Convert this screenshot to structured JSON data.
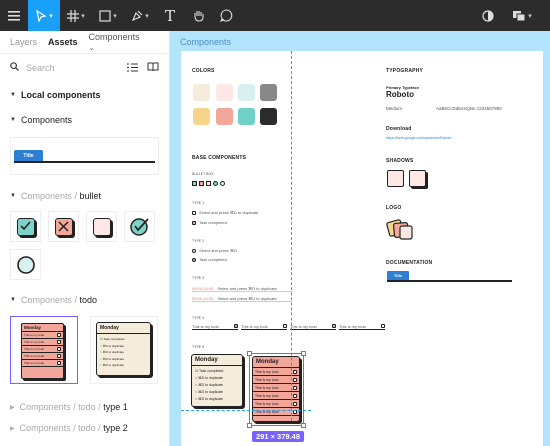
{
  "toolbar": {
    "menu_icon": "hamburger-icon",
    "move_tool_icon": "move-cursor-icon",
    "frame_tool_icon": "frame-hash-icon",
    "shape_tool_icon": "rectangle-icon",
    "pen_tool_icon": "pen-icon",
    "text_tool_icon": "T",
    "hand_tool_icon": "hand-icon",
    "comment_tool_icon": "comment-icon",
    "theme_icon": "contrast-icon",
    "component_icon": "component-icon"
  },
  "sidebar": {
    "tabs": {
      "layers": "Layers",
      "assets": "Assets",
      "library": "Components"
    },
    "search_placeholder": "Search",
    "local_components": "Local components",
    "components_header": "Components",
    "title_thumb_label": "Title",
    "bullet_group_prefix": "Components /",
    "bullet_group_name": "bullet",
    "todo_group_prefix": "Components /",
    "todo_group_name": "todo",
    "todo_thumb_title": "Monday",
    "todo_thumb_row": "This is my todo",
    "type1_prefix": "Components / todo /",
    "type1_name": "type 1",
    "type2_prefix": "Components / todo /",
    "type2_name": "type 2"
  },
  "canvas": {
    "frame_label": "Components",
    "colors_heading": "COLORS",
    "typography_heading": "TYPOGRAPHY",
    "primary_typeface_label": "Primary Typeface",
    "typeface_name": "Roboto",
    "weight_label": "Medium",
    "alphabet_sample": "AaBbCcDdEeGgNn 1234567890",
    "download_heading": "Download",
    "download_link": "https://fonts.google.com/specimen/Roboto",
    "base_components_heading": "BASE COMPONENTS",
    "bullet_label": "BULLET BOX",
    "type1_label": "TYPE 1",
    "select_text": "Select and press ⌘D to duplicate",
    "task_completed": "Task completed",
    "type2_label": "TYPE 2",
    "select_text_short": "Select and press ⌘D",
    "type3_label": "TYPE 3",
    "time_a": "09:00-10:00",
    "time_b": "09:00-10:00",
    "type4_label": "TYPE 4",
    "todo_short": "This is my todo",
    "type5_label": "TYPE 5",
    "shadows_heading": "SHADOWS",
    "logo_heading": "LOGO",
    "documentation_heading": "DOCUMENTATION",
    "doc_title": "Title",
    "monday": "Monday",
    "todo_row": "This is my todo",
    "task_complete_row": "Task completed",
    "dup_row": "⌘D to duplicate",
    "selection_size": "291 × 379.48"
  },
  "colors": {
    "accent": "#18a0fb",
    "selection": "#7b61ff",
    "swatches": [
      "#f5ecdc",
      "#fde8e6",
      "#d6f1ef",
      "#888888",
      "#f5d48c",
      "#f2a79a",
      "#6fd1c8",
      "#2b2b2b"
    ],
    "bullet_check": "#7ed3c9",
    "bullet_x": "#f2a79a",
    "bullet_empty": "#fde8e6",
    "todo_cream": "#f5ecdc",
    "todo_pink": "#f2a79a"
  }
}
